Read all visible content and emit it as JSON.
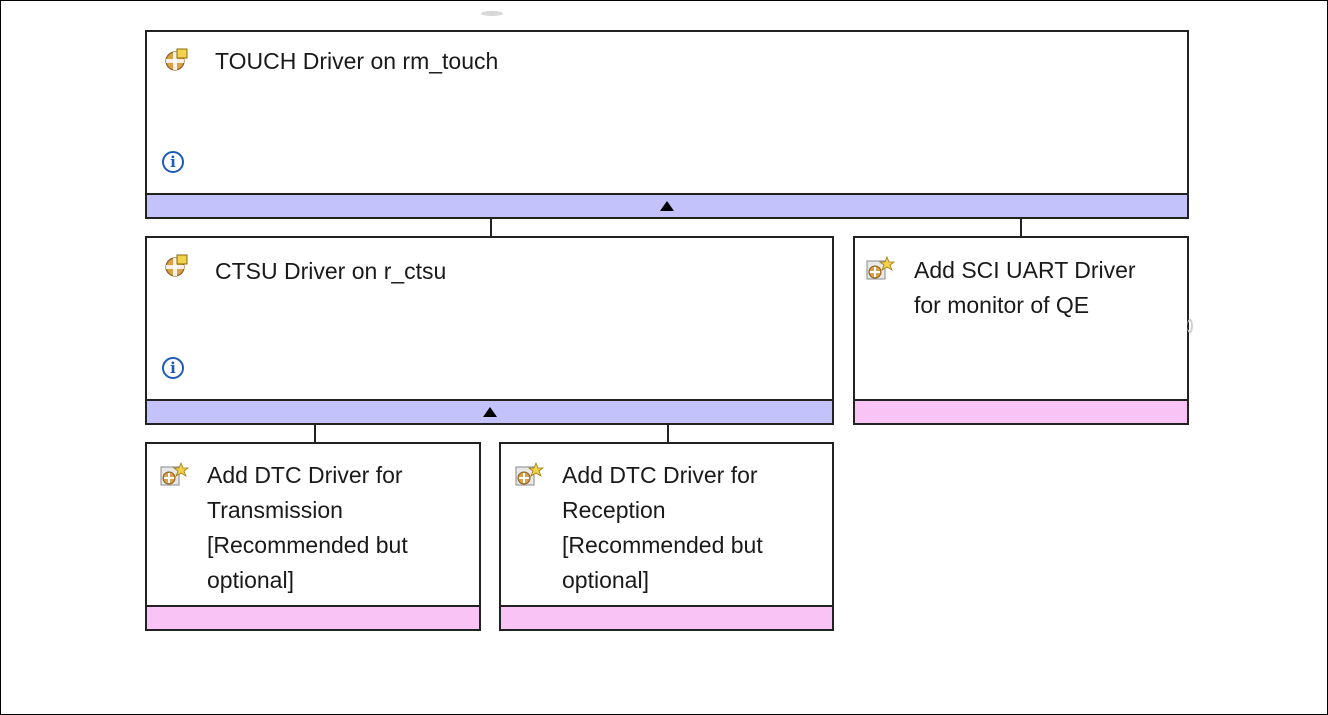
{
  "nodes": {
    "touch": {
      "title": "TOUCH Driver on rm_touch",
      "icon": "module-icon"
    },
    "ctsu": {
      "title": "CTSU Driver on r_ctsu",
      "icon": "module-icon"
    },
    "sci_uart": {
      "title_lines": [
        "Add SCI UART Driver",
        "for monitor of QE"
      ],
      "icon": "add-module-icon"
    },
    "dtc_tx": {
      "title_lines": [
        "Add DTC Driver for",
        "Transmission",
        "[Recommended but",
        "optional]"
      ],
      "icon": "add-module-icon"
    },
    "dtc_rx": {
      "title_lines": [
        "Add DTC Driver for",
        "Reception",
        "[Recommended but",
        "optional]"
      ],
      "icon": "add-module-icon"
    }
  },
  "icons": {
    "info": "info-icon",
    "collapse": "collapse-triangle-icon"
  },
  "colors": {
    "bar_blue": "#c3c2fb",
    "bar_pink": "#f9c4f5",
    "info": "#1e5bb8"
  }
}
